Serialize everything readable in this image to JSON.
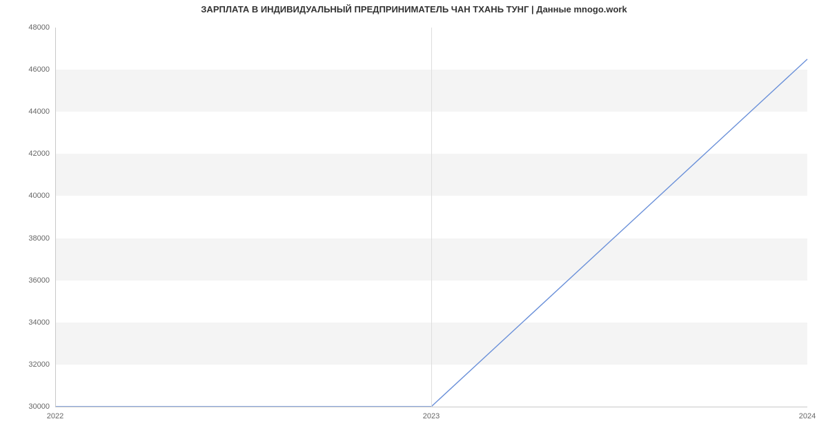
{
  "chart_data": {
    "type": "line",
    "title": "ЗАРПЛАТА В ИНДИВИДУАЛЬНЫЙ ПРЕДПРИНИМАТЕЛЬ ЧАН ТХАНЬ ТУНГ | Данные mnogo.work",
    "x": [
      2022,
      2023,
      2024
    ],
    "values": [
      30000,
      30000,
      46500
    ],
    "xlabel": "",
    "ylabel": "",
    "xlim": [
      2022,
      2024
    ],
    "ylim": [
      30000,
      48000
    ],
    "x_ticks": [
      2022,
      2023,
      2024
    ],
    "y_ticks": [
      30000,
      32000,
      34000,
      36000,
      38000,
      40000,
      42000,
      44000,
      46000,
      48000
    ],
    "line_color": "#6a90d9",
    "band_color": "#f4f4f4"
  }
}
